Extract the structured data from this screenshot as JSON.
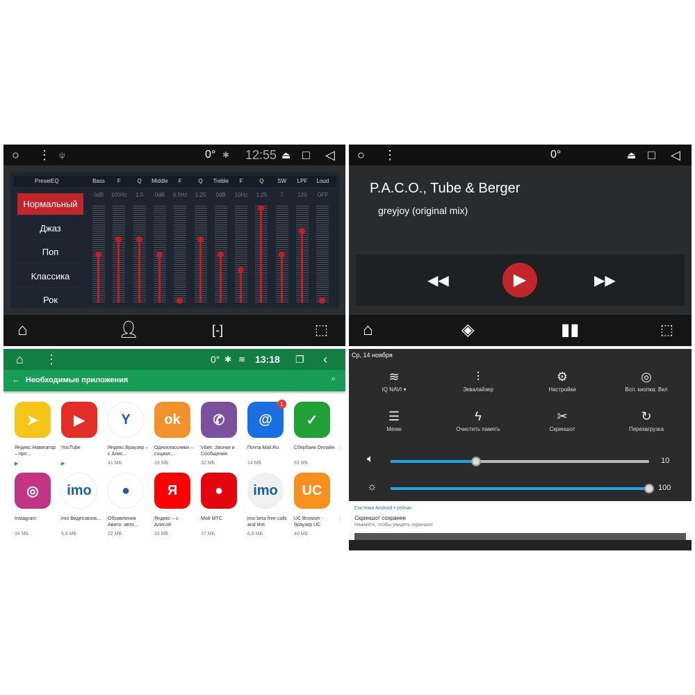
{
  "equalizer": {
    "status": {
      "temp": "0°",
      "time": "12:55"
    },
    "header_preset": "PresetEQ",
    "presets": [
      {
        "label": "Нормальный",
        "active": true
      },
      {
        "label": "Джаз"
      },
      {
        "label": "Поп"
      },
      {
        "label": "Классика"
      },
      {
        "label": "Рок"
      }
    ],
    "bands": [
      {
        "label": "Bass",
        "value": "0dB",
        "level": 0.5
      },
      {
        "label": "F",
        "value": "100Hz",
        "level": 0.66
      },
      {
        "label": "Q",
        "value": "1.5",
        "level": 0.66
      },
      {
        "label": "Middle",
        "value": "0dB",
        "level": 0.5
      },
      {
        "label": "F",
        "value": "0.5Hz",
        "level": 0.03
      },
      {
        "label": "Q",
        "value": "1.25",
        "level": 0.66
      },
      {
        "label": "Treble",
        "value": "0dB",
        "level": 0.5
      },
      {
        "label": "F",
        "value": "10Hz",
        "level": 0.34
      },
      {
        "label": "Q",
        "value": "1.25",
        "level": 0.98
      },
      {
        "label": "SW",
        "value": "7",
        "level": 0.5
      },
      {
        "label": "LPF",
        "value": "120",
        "level": 0.74
      },
      {
        "label": "Loud",
        "value": "OFF",
        "level": 0.03
      }
    ],
    "accent": "#c0262b"
  },
  "player": {
    "status": {
      "temp": "0°"
    },
    "artist": "P.A.C.O., Tube & Berger",
    "track": "greyjoy (original mix)"
  },
  "store": {
    "status": {
      "temp": "0°",
      "time": "13:18"
    },
    "title": "Необходимые приложения",
    "color": "#169c55",
    "apps": [
      {
        "name": "Яндекс.Навигатор – про...",
        "size": "",
        "icon": "navigator",
        "color": "#f5c518",
        "glyph": "➤"
      },
      {
        "name": "YouTube",
        "size": "",
        "icon": "youtube",
        "color": "#e52d27",
        "glyph": "▶"
      },
      {
        "name": "Яндекс.Браузер – с Алис...",
        "size": "41 МБ",
        "icon": "yandex-browser",
        "color": "#ffffff",
        "glyph": "Y"
      },
      {
        "name": "Одноклассники – социал...",
        "size": "33 МБ",
        "icon": "odnoklassniki",
        "color": "#f2922a",
        "glyph": "ok"
      },
      {
        "name": "Viber: Звонки и Сообщения",
        "size": "32 МБ",
        "icon": "viber",
        "color": "#7b519d",
        "glyph": "✆"
      },
      {
        "name": "Почта Mail.Ru",
        "size": "14 МБ",
        "icon": "mail-ru",
        "color": "#1a6fe0",
        "glyph": "@",
        "badge": "1"
      },
      {
        "name": "Сбербанк Онлайн",
        "size": "83 МБ",
        "icon": "sberbank",
        "color": "#21a038",
        "glyph": "✓"
      },
      {
        "name": "Instagram",
        "size": "34 МБ",
        "icon": "instagram",
        "color": "#c13584",
        "glyph": "◎"
      },
      {
        "name": "imo Видеозвонк...",
        "size": "6,8 МБ",
        "icon": "imo",
        "color": "#ffffff",
        "glyph": "imo"
      },
      {
        "name": "Объявления Авито: авто...",
        "size": "22 МБ",
        "icon": "avito",
        "color": "#ffffff",
        "glyph": "●"
      },
      {
        "name": "Яндекс – с Алисой",
        "size": "33 МБ",
        "icon": "yandex",
        "color": "#f00",
        "glyph": "Я"
      },
      {
        "name": "Мой МТС",
        "size": "37 МБ",
        "icon": "mts",
        "color": "#e30611",
        "glyph": "●"
      },
      {
        "name": "imo beta free calls and text",
        "size": "6,8 МБ",
        "icon": "imo-beta",
        "color": "#f0f0f0",
        "glyph": "imo"
      },
      {
        "name": "UC Browser - браузер UC",
        "size": "40 МБ",
        "icon": "uc-browser",
        "color": "#f7901e",
        "glyph": "UC"
      }
    ]
  },
  "quick": {
    "date": "Ср, 14 ноября",
    "tiles": [
      {
        "label": "IQ NAVI ▾",
        "icon": "wifi-icon",
        "glyph": "≋"
      },
      {
        "label": "Эквалайзер",
        "icon": "equalizer-icon",
        "glyph": "⫶"
      },
      {
        "label": "Настройки",
        "icon": "gear-icon",
        "glyph": "⚙"
      },
      {
        "label": "Всп. кнопка: Вкл",
        "icon": "target-icon",
        "glyph": "◎"
      },
      {
        "label": "Меню",
        "icon": "menu-icon",
        "glyph": "☰"
      },
      {
        "label": "Очистить память",
        "icon": "clear-memory-icon",
        "glyph": "ϟ"
      },
      {
        "label": "Скриншот",
        "icon": "scissors-icon",
        "glyph": "✂"
      },
      {
        "label": "Перезагрузка",
        "icon": "restart-icon",
        "glyph": "↻"
      }
    ],
    "volume": {
      "value": "10",
      "fraction": 0.33
    },
    "brightness": {
      "value": "100",
      "fraction": 1.0
    },
    "notification": {
      "source": "Система Android • сейчас",
      "title": "Скриншот сохранен",
      "text": "Нажмите, чтобы увидеть скриншот"
    },
    "slider_color": "#1fa5e6"
  }
}
